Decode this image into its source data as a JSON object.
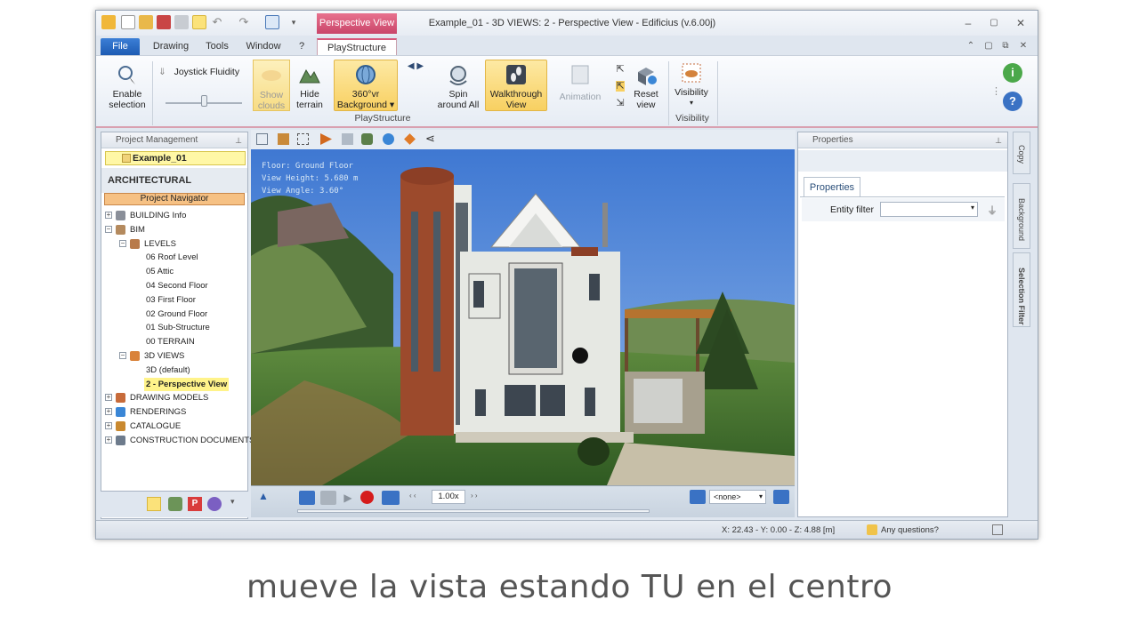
{
  "window": {
    "title": "Example_01 - 3D VIEWS: 2 - Perspective View - Edificius (v.6.00j)",
    "context_tab": "Perspective View",
    "controls": [
      "–",
      "▢",
      "✕"
    ],
    "sub_controls": [
      "⌃",
      "▢",
      "⧉",
      "✕"
    ]
  },
  "menu": {
    "file": "File",
    "items": [
      "Drawing",
      "Tools",
      "Window",
      "?"
    ],
    "active_tab": "PlayStructure"
  },
  "ribbon": {
    "enable_selection": [
      "Enable",
      "selection"
    ],
    "joystick_fluidity": "Joystick Fluidity",
    "show_clouds": [
      "Show",
      "clouds"
    ],
    "hide_terrain": [
      "Hide",
      "terrain"
    ],
    "background_360": [
      "360°vr",
      "Background ▾"
    ],
    "spin_around": [
      "Spin",
      "around All"
    ],
    "walkthrough_view": [
      "Walkthrough",
      "View"
    ],
    "animation": "Animation",
    "reset_view": [
      "Reset",
      "view"
    ],
    "visibility": [
      "Visibility",
      "▾"
    ],
    "group_playstructure": "PlayStructure",
    "group_visibility": "Visibility"
  },
  "left_panel": {
    "header": "Project Management",
    "project": "Example_01",
    "section": "ARCHITECTURAL",
    "navigator": "Project Navigator",
    "tree": [
      {
        "label": "BUILDING Info",
        "indent": 0,
        "expander": "+",
        "color": "#8a8f99"
      },
      {
        "label": "BIM",
        "indent": 0,
        "expander": "−",
        "color": "#b48a5e"
      },
      {
        "label": "LEVELS",
        "indent": 1,
        "expander": "−",
        "color": "#b87a4a"
      },
      {
        "label": "06 Roof Level",
        "indent": 2,
        "expander": "",
        "color": ""
      },
      {
        "label": "05 Attic",
        "indent": 2,
        "expander": "",
        "color": ""
      },
      {
        "label": "04 Second Floor",
        "indent": 2,
        "expander": "",
        "color": ""
      },
      {
        "label": "03 First Floor",
        "indent": 2,
        "expander": "",
        "color": ""
      },
      {
        "label": "02 Ground Floor",
        "indent": 2,
        "expander": "",
        "color": ""
      },
      {
        "label": "01 Sub-Structure",
        "indent": 2,
        "expander": "",
        "color": ""
      },
      {
        "label": "00 TERRAIN",
        "indent": 2,
        "expander": "",
        "color": ""
      },
      {
        "label": "3D VIEWS",
        "indent": 1,
        "expander": "−",
        "color": "#d9823a"
      },
      {
        "label": "3D (default)",
        "indent": 2,
        "expander": "",
        "color": ""
      },
      {
        "label": "2 - Perspective View",
        "indent": 2,
        "expander": "",
        "color": "",
        "selected": true
      },
      {
        "label": "DRAWING MODELS",
        "indent": 0,
        "expander": "+",
        "color": "#c76b3a"
      },
      {
        "label": "RENDERINGS",
        "indent": 0,
        "expander": "+",
        "color": "#3a86d6"
      },
      {
        "label": "CATALOGUE",
        "indent": 0,
        "expander": "+",
        "color": "#c9892f"
      },
      {
        "label": "CONSTRUCTION DOCUMENTS",
        "indent": 0,
        "expander": "+",
        "color": "#6d7b8c"
      }
    ]
  },
  "viewport": {
    "floor": "Floor: Ground Floor",
    "view_height": "View Height: 5.680 m",
    "view_angle": "View Angle: 3.60°"
  },
  "playbar": {
    "speed": "1.00x",
    "camera": "<none>"
  },
  "right_panel": {
    "header": "Properties",
    "tab": "Properties",
    "entity_filter_label": "Entity filter",
    "entity_filter_value": ""
  },
  "side_tabs": [
    "Copy",
    "Background",
    "Selection Filter"
  ],
  "status": {
    "coords": "X: 22.43 - Y: 0.00 - Z: 4.88 [m]",
    "help": "Any questions?"
  },
  "subtitle": "mueve la vista estando TU en el centro",
  "colors": {
    "accent_pink": "#d7587b",
    "selection_yellow": "#f8d061",
    "file_blue": "#1d5bb3"
  }
}
